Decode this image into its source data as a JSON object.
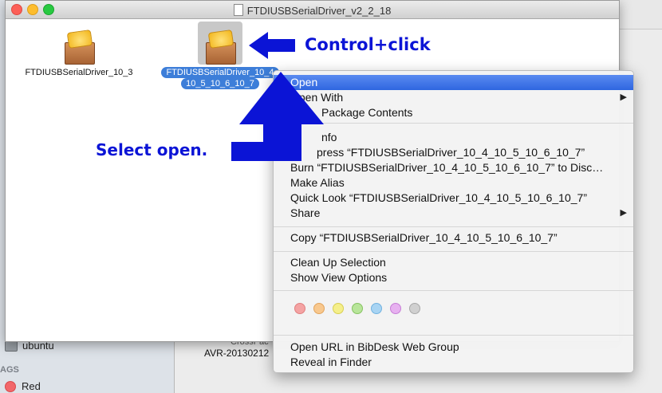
{
  "window": {
    "title": "FTDIUSBSerialDriver_v2_2_18"
  },
  "items": [
    {
      "label": "FTDIUSBSerialDriver_10_3"
    },
    {
      "label_line1": "FTDIUSBSerialDriver_10_4",
      "label_line2": "10_5_10_6_10_7"
    }
  ],
  "annotations": {
    "control_click": "Control+click",
    "select_open": "Select open."
  },
  "sidebar": {
    "ubuntu": "ubuntu",
    "tags_header": "AGS",
    "red_tag": "Red"
  },
  "background": {
    "avr_text": "AVR-20130212",
    "cross_text": "CrossPac"
  },
  "menu": {
    "open": "Open",
    "open_with": "Open With",
    "show_package_contents": "Package Contents",
    "get_info": "nfo",
    "compress": "press “FTDIUSBSerialDriver_10_4_10_5_10_6_10_7”",
    "burn": "Burn “FTDIUSBSerialDriver_10_4_10_5_10_6_10_7” to Disc…",
    "make_alias": "Make Alias",
    "quick_look": "Quick Look “FTDIUSBSerialDriver_10_4_10_5_10_6_10_7”",
    "share": "Share",
    "copy": "Copy “FTDIUSBSerialDriver_10_4_10_5_10_6_10_7”",
    "clean_up": "Clean Up Selection",
    "show_view_options": "Show View Options",
    "open_url": "Open URL in BibDesk Web Group",
    "reveal": "Reveal in Finder"
  },
  "colors": {
    "menu_highlight": "#3d72e6",
    "selection": "#3d7ed9",
    "annotation": "#0b14d6",
    "tag_colors": [
      "#f4a3a3",
      "#f8c88e",
      "#f5ef8a",
      "#b8e59a",
      "#a8d4f3",
      "#e7b1f0",
      "#d0d0d0"
    ]
  }
}
